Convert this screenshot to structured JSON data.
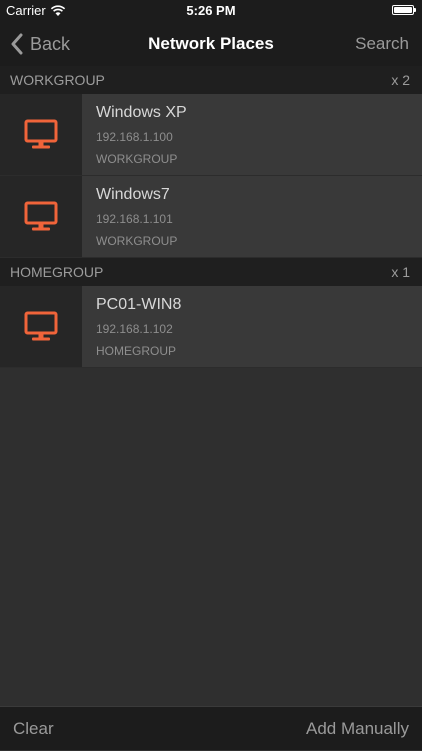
{
  "status_bar": {
    "carrier": "Carrier",
    "time": "5:26 PM"
  },
  "nav": {
    "back_label": "Back",
    "title": "Network Places",
    "search_label": "Search"
  },
  "sections": [
    {
      "name": "WORKGROUP",
      "count": "x 2",
      "items": [
        {
          "name": "Windows XP",
          "ip": "192.168.1.100",
          "group": "WORKGROUP"
        },
        {
          "name": "Windows7",
          "ip": "192.168.1.101",
          "group": "WORKGROUP"
        }
      ]
    },
    {
      "name": "HOMEGROUP",
      "count": "x 1",
      "items": [
        {
          "name": "PC01-WIN8",
          "ip": "192.168.1.102",
          "group": "HOMEGROUP"
        }
      ]
    }
  ],
  "bottom": {
    "clear_label": "Clear",
    "add_label": "Add Manually"
  },
  "icons": {
    "computer": "monitor-icon",
    "back": "chevron-left-icon",
    "wifi": "wifi-icon",
    "battery": "battery-icon"
  },
  "colors": {
    "accent": "#f0643a",
    "background": "#2f2f2f",
    "bar": "#1c1c1c"
  }
}
